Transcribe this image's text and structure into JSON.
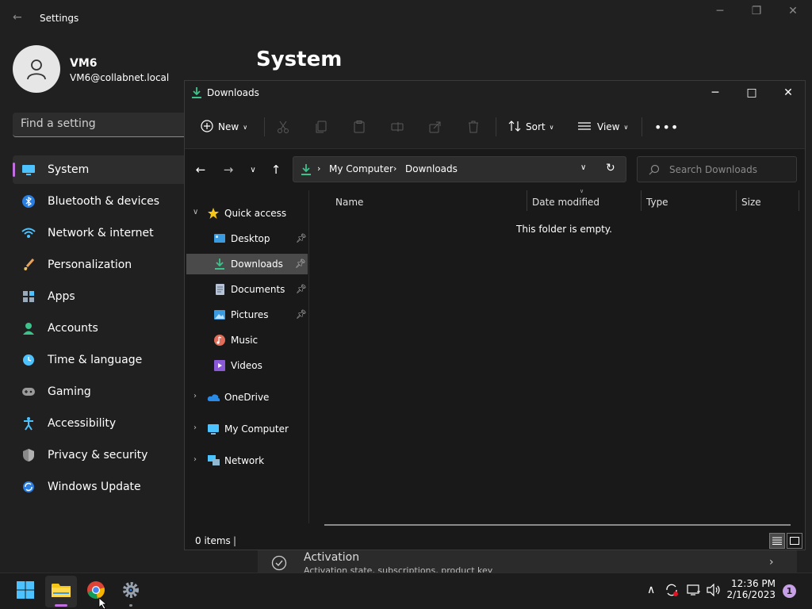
{
  "settings": {
    "title": "Settings",
    "user": {
      "name": "VM6",
      "email": "VM6@collabnet.local"
    },
    "search_placeholder": "Find a setting",
    "nav": [
      {
        "label": "System",
        "icon": "system-icon",
        "active": true
      },
      {
        "label": "Bluetooth & devices",
        "icon": "bluetooth-icon"
      },
      {
        "label": "Network & internet",
        "icon": "wifi-icon"
      },
      {
        "label": "Personalization",
        "icon": "brush-icon"
      },
      {
        "label": "Apps",
        "icon": "apps-icon"
      },
      {
        "label": "Accounts",
        "icon": "person-icon"
      },
      {
        "label": "Time & language",
        "icon": "clock-globe-icon"
      },
      {
        "label": "Gaming",
        "icon": "gamepad-icon"
      },
      {
        "label": "Accessibility",
        "icon": "accessibility-icon"
      },
      {
        "label": "Privacy & security",
        "icon": "shield-icon"
      },
      {
        "label": "Windows Update",
        "icon": "update-icon"
      }
    ],
    "page_title": "System",
    "activation": {
      "label": "Activation",
      "subtitle": "Activation state, subscriptions, product key"
    }
  },
  "explorer": {
    "title": "Downloads",
    "toolbar": {
      "new_label": "New",
      "sort_label": "Sort",
      "view_label": "View"
    },
    "breadcrumb": [
      "My Computer",
      "Downloads"
    ],
    "search_placeholder": "Search Downloads",
    "quick_access": {
      "label": "Quick access",
      "items": [
        {
          "label": "Desktop",
          "pinned": true
        },
        {
          "label": "Downloads",
          "pinned": true,
          "selected": true
        },
        {
          "label": "Documents",
          "pinned": true
        },
        {
          "label": "Pictures",
          "pinned": true
        },
        {
          "label": "Music",
          "pinned": false
        },
        {
          "label": "Videos",
          "pinned": false
        }
      ]
    },
    "roots": [
      "OneDrive",
      "My Computer",
      "Network"
    ],
    "columns": [
      "Name",
      "Date modified",
      "Type",
      "Size"
    ],
    "empty_text": "This folder is empty.",
    "status": "0 items"
  },
  "taskbar": {
    "time": "12:36 PM",
    "date": "2/16/2023",
    "notification_count": "1"
  },
  "colors": {
    "accent": "#c06ee0",
    "folder_green": "#3cc28a",
    "background": "#202020"
  }
}
